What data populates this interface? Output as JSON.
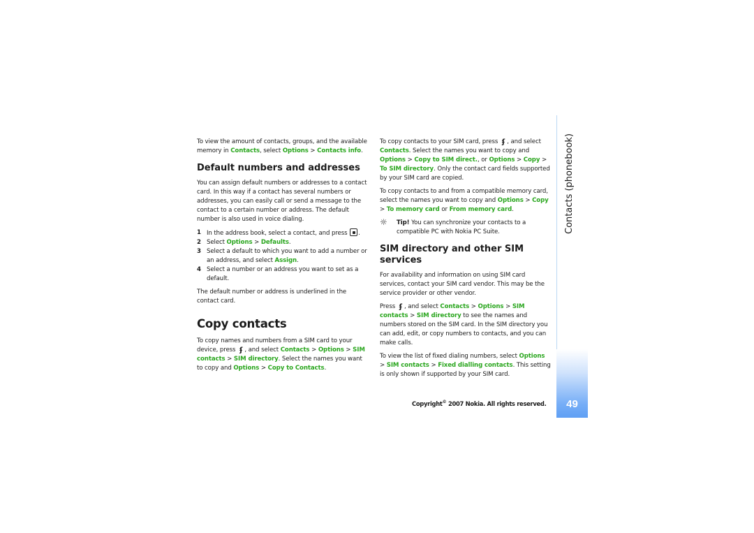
{
  "side": {
    "section_title": "Contacts (phonebook)",
    "page_number": "49",
    "accent_color": "#5f9ff4"
  },
  "footer": {
    "copyright_prefix": "Copyright",
    "copyright_symbol": "©",
    "copyright_text": "2007 Nokia. All rights reserved."
  },
  "left": {
    "intro": {
      "t1": "To view the amount of contacts, groups, and the available memory in ",
      "l1": "Contacts",
      "t2": ", select ",
      "l2": "Options",
      "t3": " > ",
      "l3": "Contacts info",
      "t4": "."
    },
    "default_heading": "Default numbers and addresses",
    "default_para": "You can assign default numbers or addresses to a contact card. In this way if a contact has several numbers or addresses, you can easily call or send a message to the contact to a certain number or address. The default number is also used in voice dialing.",
    "steps": [
      {
        "num": "1",
        "t1": "In the address book, select a contact, and press ",
        "icon": "select-key-icon",
        "t2": "."
      },
      {
        "num": "2",
        "t1": "Select ",
        "l1": "Options",
        "t2": " > ",
        "l2": "Defaults",
        "t3": "."
      },
      {
        "num": "3",
        "t1": "Select a default to which you want to add a number or an address, and select ",
        "l1": "Assign",
        "t2": "."
      },
      {
        "num": "4",
        "t1": "Select a number or an address you want to set as a default."
      }
    ],
    "underline_note": "The default number or address is underlined in the contact card.",
    "copy_heading": "Copy contacts",
    "copy_para": {
      "t1": "To copy names and numbers from a SIM card to your device, press ",
      "t2": ", and select ",
      "l1": "Contacts",
      "t3": " > ",
      "l2": "Options",
      "t4": " > ",
      "l3": "SIM contacts",
      "t5": " > ",
      "l4": "SIM directory",
      "t6": ". Select the names you want to copy and ",
      "l5": "Options",
      "t7": " > ",
      "l6": "Copy to Contacts",
      "t8": "."
    }
  },
  "right": {
    "p1": {
      "t1": "To copy contacts to your SIM card, press ",
      "t2": ", and select ",
      "l1": "Contacts",
      "t3": ". Select the names you want to copy and ",
      "l2": "Options",
      "t4": " > ",
      "l3": "Copy to SIM direct.",
      "t5": ", or ",
      "l4": "Options",
      "t6": " > ",
      "l5": "Copy",
      "t7": " > ",
      "l6": "To SIM directory",
      "t8": ". Only the contact card fields supported by your SIM card are copied."
    },
    "p2": {
      "t1": "To copy contacts to and from a compatible memory card, select the names you want to copy and ",
      "l1": "Options",
      "t2": " > ",
      "l2": "Copy",
      "t3": " > ",
      "l3": "To memory card",
      "t4": " or ",
      "l4": "From memory card",
      "t5": "."
    },
    "tip": {
      "label": "Tip!",
      "text": " You can synchronize your contacts to a compatible PC with Nokia PC Suite."
    },
    "sim_heading": "SIM directory and other SIM services",
    "sim_para": "For availability and information on using SIM card services, contact your SIM card vendor. This may be the service provider or other vendor.",
    "p3": {
      "t1": "Press ",
      "t2": ", and select ",
      "l1": "Contacts",
      "t3": " > ",
      "l2": "Options",
      "t4": " > ",
      "l3": "SIM contacts",
      "t5": " > ",
      "l4": "SIM directory",
      "t6": " to see the names and numbers stored on the SIM card. In the SIM directory you can add, edit, or copy numbers to contacts, and you can make calls."
    },
    "p4": {
      "t1": "To view the list of fixed dialing numbers, select ",
      "l1": "Options",
      "t2": " > ",
      "l2": "SIM contacts",
      "t3": " > ",
      "l3": "Fixed dialling contacts",
      "t4": ". This setting is only shown if supported by your SIM card."
    }
  },
  "icons": {
    "menu_key": "ʄ",
    "tip_bulb": "☼"
  }
}
